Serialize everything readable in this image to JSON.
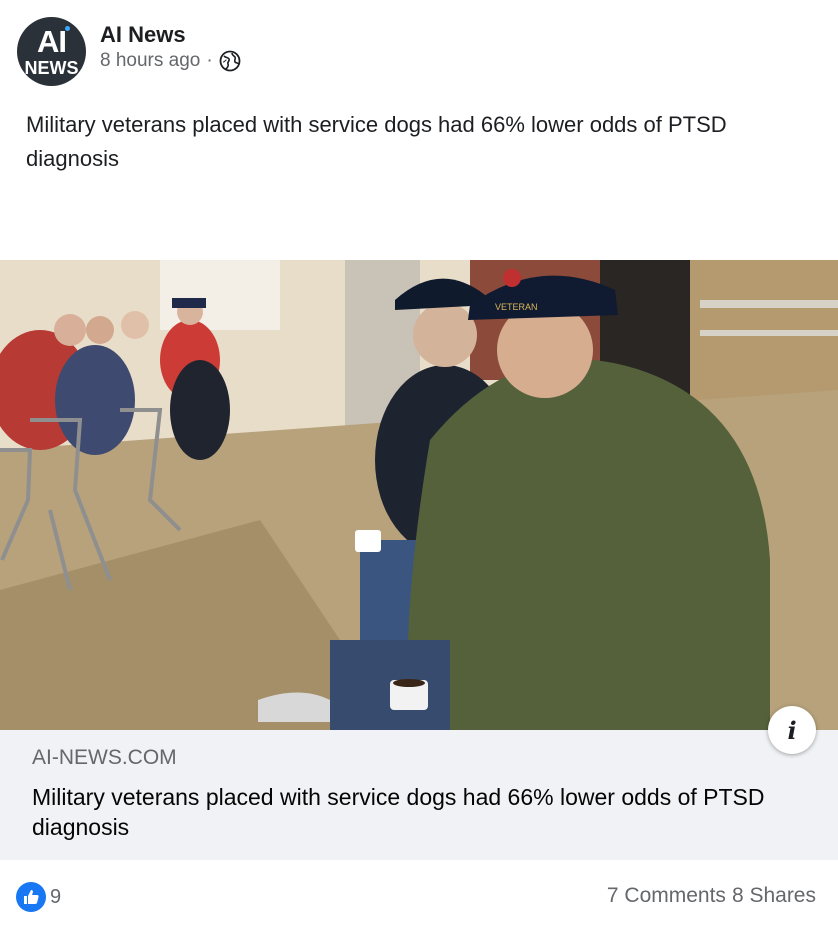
{
  "post": {
    "page_name": "AI News",
    "timestamp": "8 hours ago",
    "separator": "·",
    "audience_icon": "globe-icon",
    "avatar": {
      "line1": "AI",
      "line2": "NEWS"
    },
    "text": "Military veterans placed with service dogs had 66% lower odds of PTSD diagnosis"
  },
  "link_preview": {
    "domain": "AI-NEWS.COM",
    "title": "Military veterans placed with service dogs had 66% lower odds of PTSD diagnosis",
    "info_icon": "info-icon",
    "info_label": "i"
  },
  "footer": {
    "reaction_icon": "like-icon",
    "reaction_count": "9",
    "comments": "7 Comments",
    "shares": "8 Shares"
  },
  "colors": {
    "accent": "#1877f2",
    "secondary_text": "#65676b",
    "preview_bg": "#f0f2f5"
  }
}
